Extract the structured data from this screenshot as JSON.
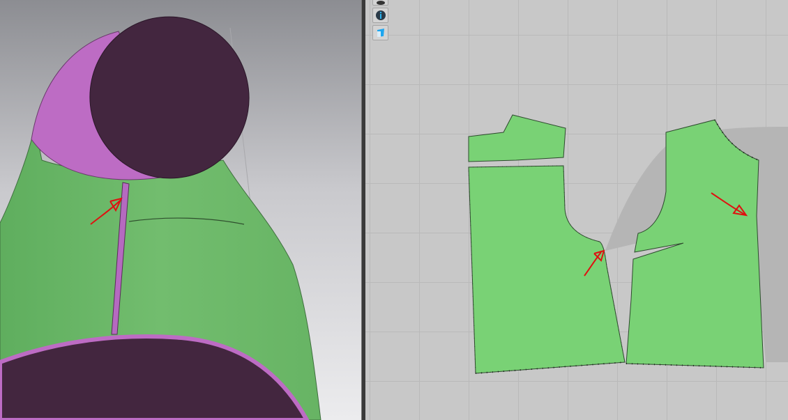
{
  "toolbar": {
    "icons": [
      "visibility-eye-icon",
      "info-icon",
      "texture-book-icon"
    ]
  },
  "colors": {
    "fabric_green": "#79d275",
    "collar_dark": "#43263f",
    "collar_pink": "#bd6cc4",
    "annotation_red": "#e01010",
    "grid_background": "#c8c8c8"
  }
}
